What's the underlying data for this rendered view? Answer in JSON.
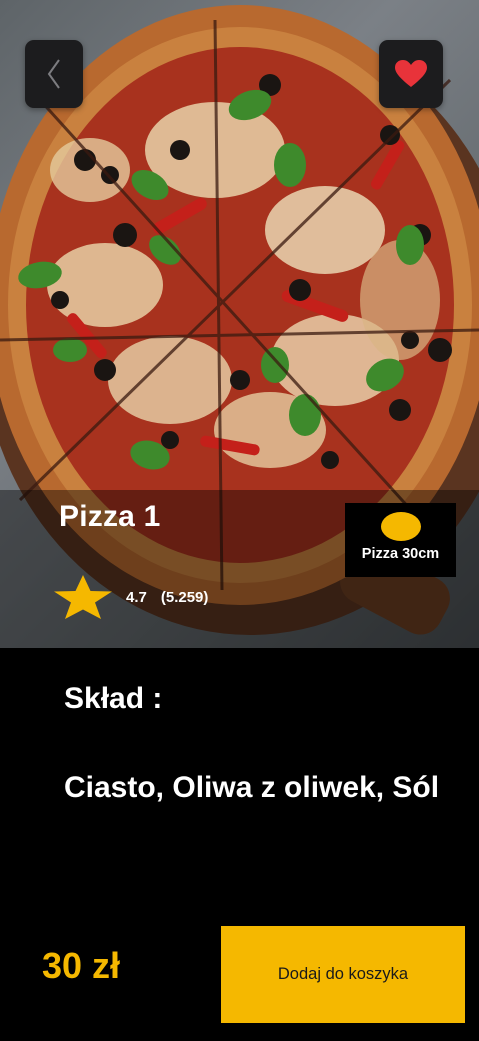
{
  "header": {
    "back_icon": "chevron-left-icon",
    "favorite_icon": "heart-icon"
  },
  "product": {
    "name": "Pizza 1",
    "rating": "4.7",
    "rating_count": "(5.259)",
    "rating_icon": "star-icon",
    "size_label": "Pizza 30cm"
  },
  "ingredients": {
    "heading": "Skład :",
    "text": "Ciasto, Oliwa z oliwek, Sól"
  },
  "footer": {
    "price": "30 zł",
    "add_to_cart_label": "Dodaj do koszyka"
  },
  "colors": {
    "accent": "#f5b800",
    "background": "#000000",
    "button_dark": "#1c1c1e",
    "favorite": "#e8333a"
  }
}
